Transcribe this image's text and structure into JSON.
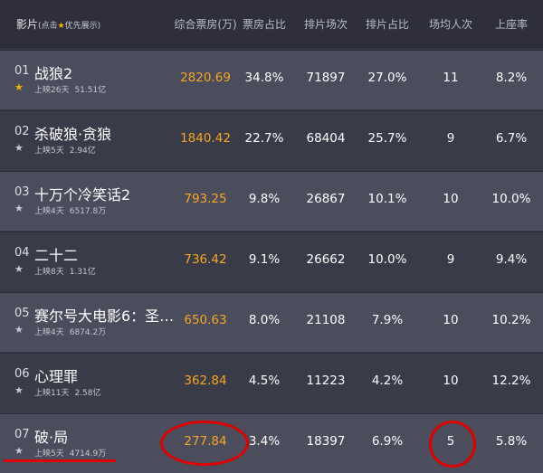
{
  "header": {
    "film": "影片",
    "film_note_1": "(点击",
    "film_note_2": "优先展示)",
    "box": "综合票房(万)",
    "box_share": "票房占比",
    "shows": "排片场次",
    "show_share": "排片占比",
    "avg": "场均人次",
    "occupancy": "上座率"
  },
  "rows": [
    {
      "rank": "01",
      "title": "战狼2",
      "days": "上映26天",
      "total": "51.51亿",
      "box": "2820.69",
      "box_share": "34.8%",
      "shows": "71897",
      "show_share": "27.0%",
      "avg": "11",
      "occupancy": "8.2%",
      "starred": true
    },
    {
      "rank": "02",
      "title": "杀破狼·贪狼",
      "days": "上映5天",
      "total": "2.94亿",
      "box": "1840.42",
      "box_share": "22.7%",
      "shows": "68404",
      "show_share": "25.7%",
      "avg": "9",
      "occupancy": "6.7%",
      "starred": false
    },
    {
      "rank": "03",
      "title": "十万个冷笑话2",
      "days": "上映4天",
      "total": "6517.8万",
      "box": "793.25",
      "box_share": "9.8%",
      "shows": "26867",
      "show_share": "10.1%",
      "avg": "10",
      "occupancy": "10.0%",
      "starred": false
    },
    {
      "rank": "04",
      "title": "二十二",
      "days": "上映8天",
      "total": "1.31亿",
      "box": "736.42",
      "box_share": "9.1%",
      "shows": "26662",
      "show_share": "10.0%",
      "avg": "9",
      "occupancy": "9.4%",
      "starred": false
    },
    {
      "rank": "05",
      "title": "赛尔号大电影6：圣…",
      "days": "上映4天",
      "total": "6874.2万",
      "box": "650.63",
      "box_share": "8.0%",
      "shows": "21108",
      "show_share": "7.9%",
      "avg": "10",
      "occupancy": "10.2%",
      "starred": false
    },
    {
      "rank": "06",
      "title": "心理罪",
      "days": "上映11天",
      "total": "2.58亿",
      "box": "362.84",
      "box_share": "4.5%",
      "shows": "11223",
      "show_share": "4.2%",
      "avg": "10",
      "occupancy": "12.2%",
      "starred": false
    },
    {
      "rank": "07",
      "title": "破·局",
      "days": "上映5天",
      "total": "4714.9万",
      "box": "277.84",
      "box_share": "3.4%",
      "shows": "18397",
      "show_share": "6.9%",
      "avg": "5",
      "occupancy": "5.8%",
      "starred": false
    }
  ],
  "colors": {
    "box_value": "#f6a623",
    "star_active": "#f5b700",
    "star_inactive": "#c9cad3",
    "annotation": "#e00000"
  }
}
